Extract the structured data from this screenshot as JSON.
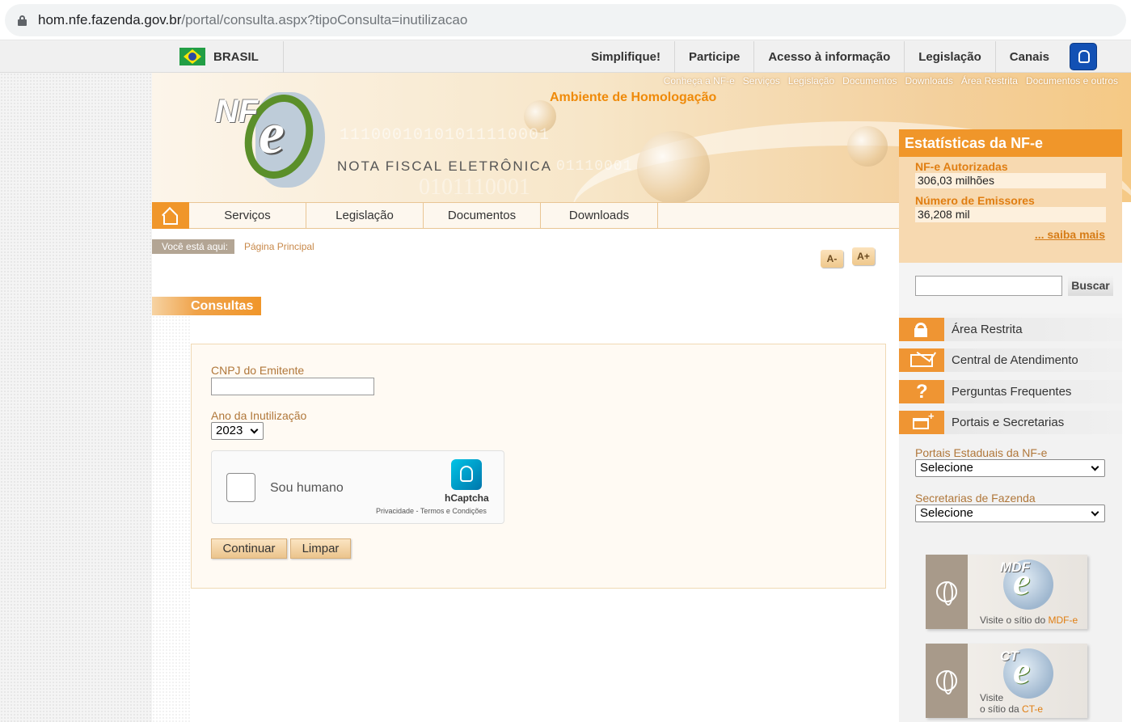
{
  "browser": {
    "url_host": "hom.nfe.fazenda.gov.br",
    "url_path": "/portal/consulta.aspx?tipoConsulta=inutilizacao"
  },
  "gov_bar": {
    "country": "BRASIL",
    "links": [
      "Simplifique!",
      "Participe",
      "Acesso à informação",
      "Legislação",
      "Canais"
    ]
  },
  "banner": {
    "top_links": [
      "Conheça a NF-e",
      "Serviços",
      "Legislação",
      "Documentos",
      "Downloads",
      "Área Restrita",
      "Documentos e outros"
    ],
    "environment": "Ambiente de Homologação",
    "logo_nf": "NF",
    "logo_e": "e",
    "subtitle": "NOTA FISCAL ELETRÔNICA",
    "binary_a": "11100010101011110001",
    "binary_b": "01110001",
    "binary_c": "0101110001"
  },
  "main_nav": [
    "Serviços",
    "Legislação",
    "Documentos",
    "Downloads"
  ],
  "breadcrumb": {
    "label": "Você está aqui:",
    "current": "Página Principal"
  },
  "font_controls": {
    "decrease": "A-",
    "increase": "A+"
  },
  "section_title": "Consultas",
  "form": {
    "cnpj_label": "CNPJ do Emitente",
    "cnpj_value": "",
    "year_label": "Ano da Inutilização",
    "year_value": "2023",
    "captcha_text": "Sou humano",
    "captcha_brand": "hCaptcha",
    "captcha_links": "Privacidade - Termos e Condições",
    "continue_label": "Continuar",
    "clear_label": "Limpar"
  },
  "stats": {
    "title": "Estatísticas da NF-e",
    "authorized_label": "NF-e Autorizadas",
    "authorized_value": "306,03 milhões",
    "issuers_label": "Número de Emissores",
    "issuers_value": "36,208 mil",
    "more_link": "... saiba mais"
  },
  "search": {
    "button_label": "Buscar",
    "value": ""
  },
  "sidebar": {
    "items": [
      {
        "label": "Área Restrita",
        "icon": "lock-icon"
      },
      {
        "label": "Central de Atendimento",
        "icon": "envelope-icon"
      },
      {
        "label": "Perguntas Frequentes",
        "icon": "question-icon"
      },
      {
        "label": "Portais e Secretarias",
        "icon": "window-plus-icon"
      }
    ],
    "state_portals_label": "Portais Estaduais da NF-e",
    "state_portals_value": "Selecione",
    "secretaries_label": "Secretarias de Fazenda",
    "secretaries_value": "Selecione"
  },
  "promos": {
    "mdfe": {
      "brand": "MDF",
      "caption_prefix": "Visite o sítio do ",
      "caption_highlight": "MDF-e"
    },
    "cte": {
      "brand": "CT",
      "caption_line1": "Visite",
      "caption_prefix": "o sítio da ",
      "caption_highlight": "CT-e"
    }
  },
  "colors": {
    "accent_orange": "#f0962a",
    "label_brown": "#b0773a",
    "gov_blue": "#1351b4"
  }
}
